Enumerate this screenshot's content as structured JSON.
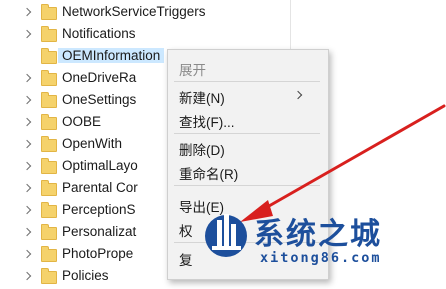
{
  "tree": {
    "items": [
      {
        "label": "NetworkServiceTriggers",
        "selected": false
      },
      {
        "label": "Notifications",
        "selected": false
      },
      {
        "label": "OEMInformation",
        "selected": true
      },
      {
        "label": "OneDriveRa",
        "selected": false
      },
      {
        "label": "OneSettings",
        "selected": false
      },
      {
        "label": "OOBE",
        "selected": false
      },
      {
        "label": "OpenWith",
        "selected": false
      },
      {
        "label": "OptimalLayo",
        "selected": false
      },
      {
        "label": "Parental Cor",
        "selected": false
      },
      {
        "label": "PerceptionS",
        "selected": false
      },
      {
        "label": "Personalizat",
        "selected": false
      },
      {
        "label": "PhotoPrope",
        "selected": false
      },
      {
        "label": "Policies",
        "selected": false
      }
    ]
  },
  "context_menu": {
    "items": [
      {
        "label": "展开",
        "disabled": true
      },
      {
        "label": "新建(N)",
        "has_submenu": true
      },
      {
        "label": "查找(F)..."
      },
      {
        "label": "删除(D)"
      },
      {
        "label": "重命名(R)"
      },
      {
        "label": "导出(E)"
      },
      {
        "label": "权"
      },
      {
        "label": "复"
      }
    ]
  },
  "watermark": {
    "text": "系统之城",
    "url": "xitong86.com",
    "color": "#1d4f9c"
  },
  "colors": {
    "selection": "#cce8ff",
    "folder": "#f5d26b",
    "pointer_arrow": "#d8201e"
  }
}
